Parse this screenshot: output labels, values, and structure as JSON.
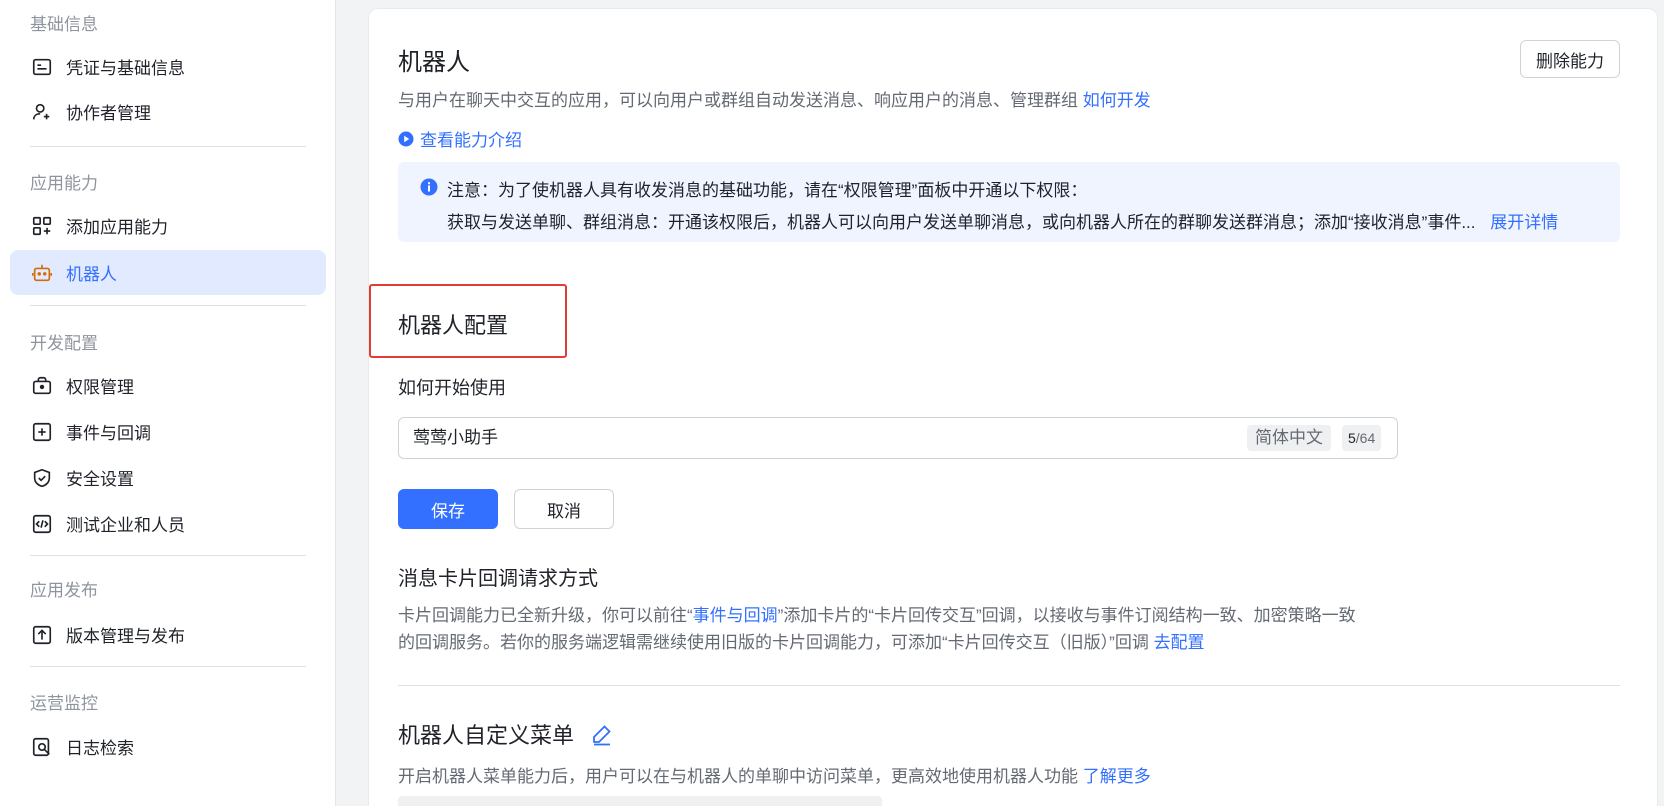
{
  "sidebar": {
    "groups": [
      {
        "title": "基础信息"
      },
      {
        "title": "应用能力"
      },
      {
        "title": "开发配置"
      },
      {
        "title": "应用发布"
      },
      {
        "title": "运营监控"
      }
    ],
    "items": [
      {
        "label": "凭证与基础信息",
        "icon": "credential-icon"
      },
      {
        "label": "协作者管理",
        "icon": "user-add-icon"
      },
      {
        "label": "添加应用能力",
        "icon": "apps-add-icon"
      },
      {
        "label": "机器人",
        "icon": "robot-icon",
        "active": true
      },
      {
        "label": "权限管理",
        "icon": "lock-briefcase-icon"
      },
      {
        "label": "事件与回调",
        "icon": "event-icon"
      },
      {
        "label": "安全设置",
        "icon": "shield-icon"
      },
      {
        "label": "测试企业和人员",
        "icon": "code-icon"
      },
      {
        "label": "版本管理与发布",
        "icon": "upload-icon"
      },
      {
        "label": "日志检索",
        "icon": "log-search-icon"
      }
    ]
  },
  "header": {
    "title": "机器人",
    "delete_label": "删除能力",
    "description": "与用户在聊天中交互的应用，可以向用户或群组自动发送消息、响应用户的消息、管理群组",
    "how_to_dev": "如何开发",
    "intro_link": "查看能力介绍"
  },
  "notice": {
    "line1": "注意：为了使机器人具有收发消息的基础功能，请在“权限管理”面板中开通以下权限：",
    "line2": "获取与发送单聊、群组消息：开通该权限后，机器人可以向用户发送单聊消息，或向机器人所在的群聊发送群消息；添加“接收消息”事件...",
    "expand": "展开详情"
  },
  "config": {
    "title": "机器人配置",
    "how_to_start_label": "如何开始使用",
    "input_value": "莺莺小助手",
    "lang_tag": "简体中文",
    "counter_current": "5",
    "counter_max": "/64",
    "save_label": "保存",
    "cancel_label": "取消"
  },
  "card_callback": {
    "title": "消息卡片回调请求方式",
    "desc1_a": "卡片回调能力已全新升级，你可以前往“",
    "desc1_link": "事件与回调",
    "desc1_b": "”添加卡片的“卡片回传交互”回调，以接收与事件订阅结构一致、加密策略一致",
    "desc2": "的回调服务。若你的服务端逻辑需继续使用旧版的卡片回调能力，可添加“卡片回传交互（旧版）”回调",
    "configure_link": "去配置"
  },
  "custom_menu": {
    "title": "机器人自定义菜单",
    "description": "开启机器人菜单能力后，用户可以在与机器人的单聊中访问菜单，更高效地使用机器人功能",
    "learn_more": "了解更多"
  },
  "colors": {
    "accent": "#3370ff",
    "highlight_border": "#e23c39",
    "notice_bg": "#f0f4ff",
    "active_bg": "#e1eaff"
  }
}
